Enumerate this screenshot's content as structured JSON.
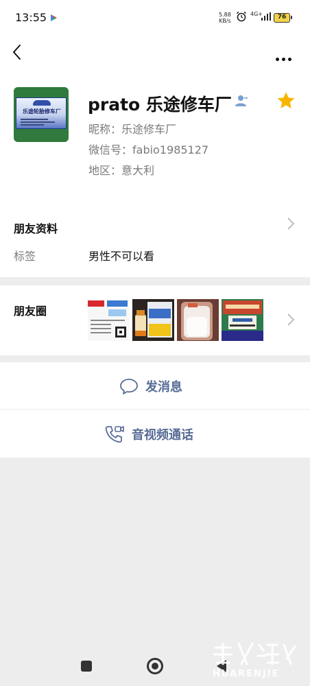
{
  "status_bar": {
    "time": "13:55",
    "net_speed": "5.88",
    "net_unit": "KB/s",
    "network": "4G+",
    "battery": "76"
  },
  "profile": {
    "name": "prato 乐途修车厂",
    "nickname": "昵称：乐途修车厂",
    "wechat_id": "微信号：fabio1985127",
    "region": "地区：意大利",
    "avatar_text": "乐途轮胎修车厂"
  },
  "friend_info": {
    "title": "朋友资料",
    "tag_label": "标签",
    "tag_value": "男性不可以看"
  },
  "moments": {
    "title": "朋友圈"
  },
  "actions": {
    "message": "发消息",
    "call": "音视频通话"
  },
  "colors": {
    "link_blue": "#576b95",
    "star_yellow": "#f7b500",
    "battery_yellow": "#f1d24a"
  },
  "watermark": {
    "text": "HUARENJIE"
  }
}
